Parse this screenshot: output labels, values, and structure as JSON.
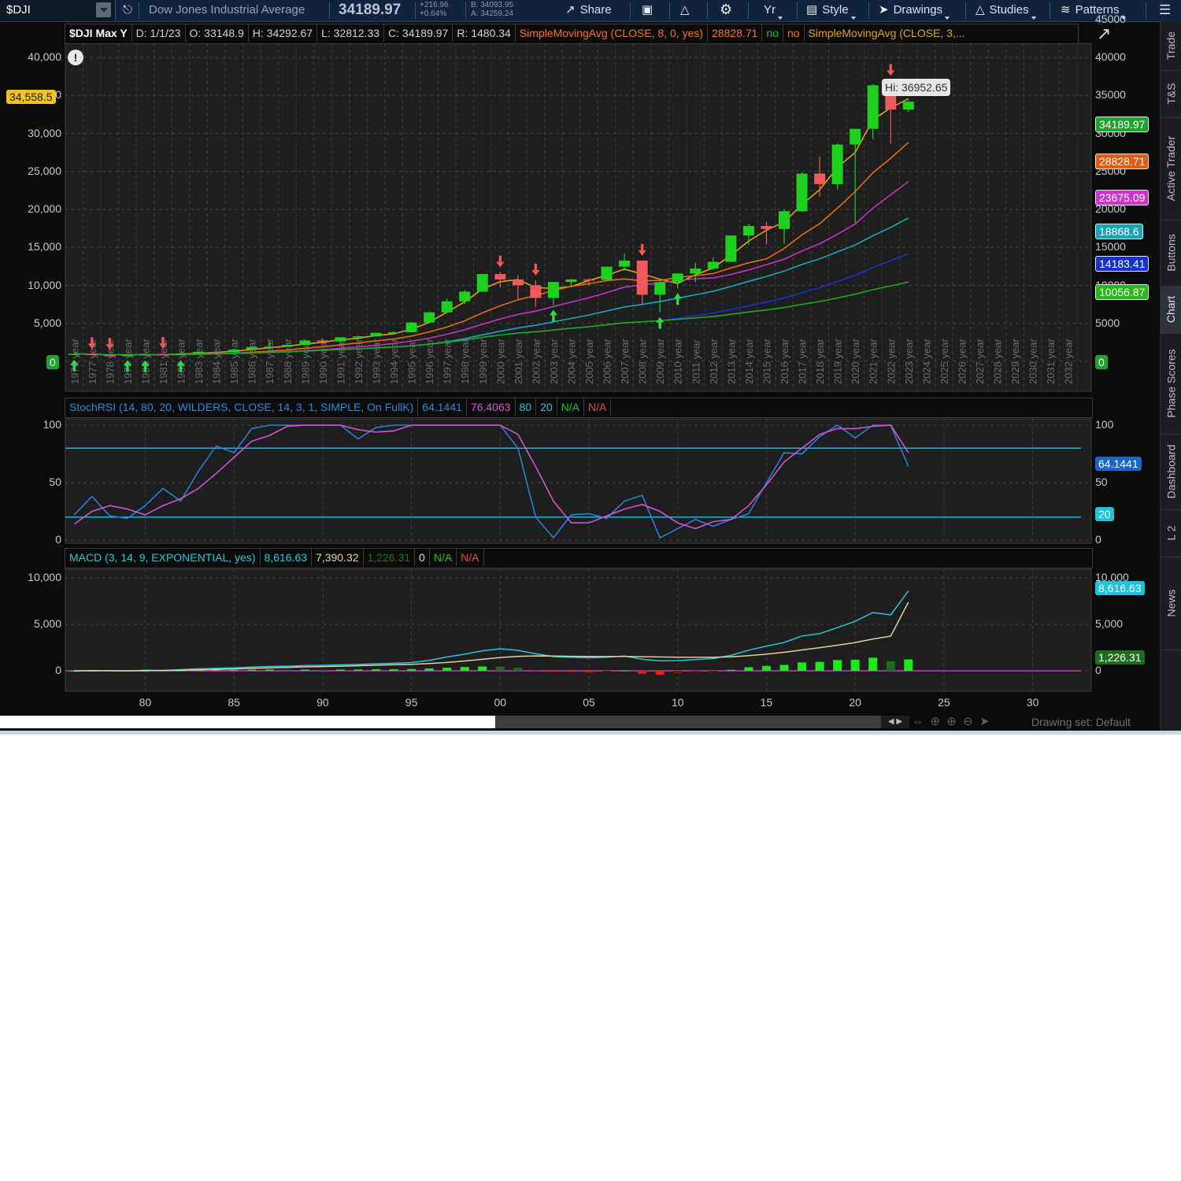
{
  "toolbar": {
    "symbol": "$DJI",
    "name": "Dow Jones Industrial Average",
    "last": "34189.97",
    "change": "+216.96",
    "change_pct": "+0.64%",
    "bid": "B: 34093.95",
    "ask": "A: 34259.24",
    "share": "Share",
    "yr": "Yr",
    "style": "Style",
    "drawings": "Drawings",
    "studies": "Studies",
    "patterns": "Patterns"
  },
  "side_tabs": [
    "Trade",
    "T&S",
    "Active Trader",
    "Buttons",
    "Chart",
    "Phase Scores",
    "Dashboard",
    "L 2",
    "News"
  ],
  "price_header": {
    "title": "$DJI Max Y",
    "date": "D: 1/1/23",
    "open": "O: 33148.9",
    "high": "H: 34292.67",
    "low": "L: 32812.33",
    "close": "C: 34189.97",
    "range": "R: 1480.34",
    "sma1": "SimpleMovingAvg (CLOSE, 8, 0, yes)",
    "sma1_val": "28828.71",
    "no1": "no",
    "no2": "no",
    "sma2": "SimpleMovingAvg (CLOSE, 3,..."
  },
  "price_axis_left": [
    "40,000",
    "35,000",
    "30,000",
    "25,000",
    "20,000",
    "15,000",
    "10,000",
    "5,000"
  ],
  "price_axis_right": [
    "45000",
    "40000",
    "35000",
    "30000",
    "25000",
    "20000",
    "15000",
    "10000",
    "5000"
  ],
  "price_tags": {
    "left_current": "34,558.5",
    "left_zero": "0",
    "right_zero": "0",
    "right": [
      {
        "text": "34189.97",
        "bg": "#1fa22e",
        "fg": "#ffffff"
      },
      {
        "text": "28828.71",
        "bg": "#e35a12",
        "fg": "#ffffff"
      },
      {
        "text": "23675.09",
        "bg": "#c936c9",
        "fg": "#ffffff"
      },
      {
        "text": "18868.6",
        "bg": "#1aa3b5",
        "fg": "#ffffff"
      },
      {
        "text": "14183.41",
        "bg": "#1730c8",
        "fg": "#ffffff"
      },
      {
        "text": "10056.87",
        "bg": "#29b51c",
        "fg": "#ffffff"
      }
    ],
    "hi": "Hi: 36952.65"
  },
  "year_labels": [
    "1976 year",
    "1977 year",
    "1978 year",
    "1979 year",
    "1980 year",
    "1981 year",
    "1982 year",
    "1983 year",
    "1984 year",
    "1985 year",
    "1986 year",
    "1987 year",
    "1988 year",
    "1989 year",
    "1990 year",
    "1991 year",
    "1992 year",
    "1993 year",
    "1994 year",
    "1995 year",
    "1996 year",
    "1997 year",
    "1998 year",
    "1999 year",
    "2000 year",
    "2001 year",
    "2002 year",
    "2003 year",
    "2004 year",
    "2005 year",
    "2006 year",
    "2007 year",
    "2008 year",
    "2009 year",
    "2010 year",
    "2011 year",
    "2012 year",
    "2013 year",
    "2014 year",
    "2015 year",
    "2016 year",
    "2017 year",
    "2018 year",
    "2019 year",
    "2020 year",
    "2021 year",
    "2022 year",
    "2023 year",
    "2024 year",
    "2025 year",
    "2026 year",
    "2027 year",
    "2028 year",
    "2029 year",
    "2030 year",
    "2031 year",
    "2032 year"
  ],
  "chart_data": {
    "type": "candlestick",
    "years": [
      1976,
      1977,
      1978,
      1979,
      1980,
      1981,
      1982,
      1983,
      1984,
      1985,
      1986,
      1987,
      1988,
      1989,
      1990,
      1991,
      1992,
      1993,
      1994,
      1995,
      1996,
      1997,
      1998,
      1999,
      2000,
      2001,
      2002,
      2003,
      2004,
      2005,
      2006,
      2007,
      2008,
      2009,
      2010,
      2011,
      2012,
      2013,
      2014,
      2015,
      2016,
      2017,
      2018,
      2019,
      2020,
      2021,
      2022,
      2023
    ],
    "ohlc": [
      [
        858,
        1014,
        859,
        1005
      ],
      [
        1005,
        1000,
        800,
        831
      ],
      [
        831,
        908,
        742,
        805
      ],
      [
        805,
        897,
        796,
        839
      ],
      [
        839,
        1000,
        759,
        964
      ],
      [
        964,
        1024,
        824,
        875
      ],
      [
        875,
        1070,
        776,
        1047
      ],
      [
        1047,
        1287,
        1027,
        1259
      ],
      [
        1259,
        1287,
        1087,
        1212
      ],
      [
        1212,
        1553,
        1185,
        1547
      ],
      [
        1547,
        1955,
        1502,
        1896
      ],
      [
        1896,
        2722,
        1739,
        1939
      ],
      [
        1939,
        2184,
        1879,
        2169
      ],
      [
        2169,
        2791,
        2144,
        2753
      ],
      [
        2753,
        2999,
        2365,
        2634
      ],
      [
        2634,
        3169,
        2470,
        3169
      ],
      [
        3169,
        3413,
        3136,
        3301
      ],
      [
        3301,
        3794,
        3242,
        3754
      ],
      [
        3754,
        3978,
        3593,
        3834
      ],
      [
        3834,
        5216,
        3832,
        5117
      ],
      [
        5117,
        6560,
        5000,
        6448
      ],
      [
        6448,
        8259,
        6391,
        7908
      ],
      [
        7908,
        9374,
        7539,
        9181
      ],
      [
        9181,
        11497,
        9121,
        11497
      ],
      [
        11497,
        11750,
        9731,
        10787
      ],
      [
        10787,
        11350,
        8062,
        10022
      ],
      [
        10022,
        10673,
        7197,
        8342
      ],
      [
        8342,
        10454,
        7416,
        10454
      ],
      [
        10454,
        10868,
        9749,
        10783
      ],
      [
        10783,
        10984,
        10012,
        10718
      ],
      [
        10718,
        12511,
        10667,
        12463
      ],
      [
        12463,
        14198,
        11939,
        13265
      ],
      [
        13265,
        13279,
        7449,
        8776
      ],
      [
        8776,
        10580,
        6470,
        10428
      ],
      [
        10428,
        11585,
        9614,
        11578
      ],
      [
        11578,
        12929,
        10404,
        12218
      ],
      [
        12218,
        13661,
        12035,
        13104
      ],
      [
        13104,
        16588,
        13104,
        16577
      ],
      [
        16577,
        18103,
        15340,
        17823
      ],
      [
        17823,
        18351,
        15370,
        17425
      ],
      [
        17425,
        19987,
        15451,
        19763
      ],
      [
        19763,
        24876,
        19677,
        24719
      ],
      [
        24719,
        26951,
        21713,
        23327
      ],
      [
        23327,
        28701,
        22639,
        28538
      ],
      [
        28538,
        30606,
        18214,
        30606
      ],
      [
        30606,
        36488,
        29242,
        36338
      ],
      [
        36338,
        36952,
        28661,
        33147
      ],
      [
        33149,
        34293,
        32812,
        34190
      ]
    ],
    "sma_period_lengths": [
      3,
      8,
      13,
      21,
      34,
      50
    ],
    "sma_end_values": [
      34189.97,
      28828.71,
      23675.09,
      18868.6,
      14183.41,
      10056.87
    ],
    "y_max": 45000,
    "stochrsi": {
      "title": "StochRSI (14, 80, 20, WILDERS, CLOSE, 14, 3, 1, SIMPLE, On FullK)",
      "fullk_last": "64.1441",
      "fulld_last": "76.4063",
      "over_bought": 80,
      "over_sold": 20,
      "na1": "N/A",
      "na2": "N/A",
      "fullk": [
        22,
        38,
        21,
        19,
        30,
        45,
        34,
        60,
        82,
        76,
        97,
        100,
        100,
        100,
        100,
        100,
        88,
        98,
        100,
        100,
        100,
        100,
        100,
        100,
        100,
        80,
        20,
        2,
        22,
        23,
        19,
        34,
        39,
        2,
        10,
        18,
        12,
        18,
        23,
        50,
        76,
        75,
        90,
        100,
        89,
        100,
        100,
        64
      ],
      "fulld": [
        14,
        25,
        30,
        27,
        22,
        30,
        36,
        45,
        58,
        72,
        86,
        91,
        99,
        100,
        100,
        100,
        96,
        94,
        95,
        100,
        100,
        100,
        100,
        100,
        100,
        92,
        64,
        34,
        15,
        15,
        21,
        27,
        31,
        25,
        15,
        10,
        16,
        18,
        30,
        48,
        68,
        80,
        92,
        97,
        97,
        99,
        100,
        76
      ],
      "axis": [
        "100",
        "50",
        "0"
      ],
      "right_axis": [
        "100",
        "50",
        "0"
      ],
      "tag_k": "64.1441",
      "tag_os": "20"
    },
    "macd": {
      "title": "MACD (3, 14, 9, EXPONENTIAL, yes)",
      "value": "8,616.63",
      "avg": "7,390.32",
      "diff": "1,226.31",
      "zero": "0",
      "na1": "N/A",
      "na2": "N/A",
      "axis": [
        "10,000",
        "5,000",
        "0"
      ],
      "right_axis": [
        "10,000",
        "5,000",
        "0"
      ],
      "tag_value": "8,616.63",
      "tag_diff": "1,226.31",
      "value_series": [
        0,
        30,
        10,
        -20,
        60,
        40,
        130,
        220,
        280,
        310,
        410,
        470,
        500,
        560,
        590,
        640,
        690,
        760,
        810,
        890,
        1130,
        1490,
        1790,
        2150,
        2370,
        2200,
        1830,
        1530,
        1450,
        1400,
        1460,
        1590,
        1250,
        1080,
        1100,
        1210,
        1320,
        1660,
        2220,
        2650,
        3050,
        3750,
        4000,
        4640,
        5330,
        6270,
        6020,
        8616
      ],
      "avg_series": [
        0,
        10,
        10,
        0,
        20,
        30,
        60,
        100,
        150,
        200,
        260,
        320,
        370,
        420,
        460,
        500,
        550,
        600,
        650,
        700,
        780,
        900,
        1060,
        1240,
        1430,
        1560,
        1600,
        1590,
        1560,
        1540,
        1530,
        1540,
        1520,
        1490,
        1470,
        1460,
        1460,
        1500,
        1630,
        1790,
        1990,
        2250,
        2490,
        2750,
        3040,
        3420,
        3730,
        7390
      ],
      "hist": [
        0,
        10,
        0,
        -10,
        20,
        5,
        40,
        60,
        80,
        80,
        120,
        140,
        130,
        130,
        120,
        130,
        140,
        160,
        160,
        190,
        250,
        330,
        410,
        470,
        450,
        330,
        80,
        -60,
        -100,
        -140,
        -90,
        40,
        -320,
        -420,
        -280,
        -180,
        -110,
        100,
        380,
        520,
        640,
        900,
        960,
        1160,
        1190,
        1410,
        1010,
        1226
      ],
      "x_ticks": [
        "80",
        "85",
        "90",
        "95",
        "00",
        "05",
        "10",
        "15",
        "20",
        "25",
        "30"
      ]
    },
    "signals_up_years": [
      1976,
      1979,
      1980,
      1982,
      2003,
      2009,
      2010
    ],
    "signals_down_years": [
      1977,
      1978,
      1981,
      2000,
      2002,
      2008,
      2022
    ]
  },
  "footer": {
    "drawing_set": "Drawing set: Default"
  }
}
